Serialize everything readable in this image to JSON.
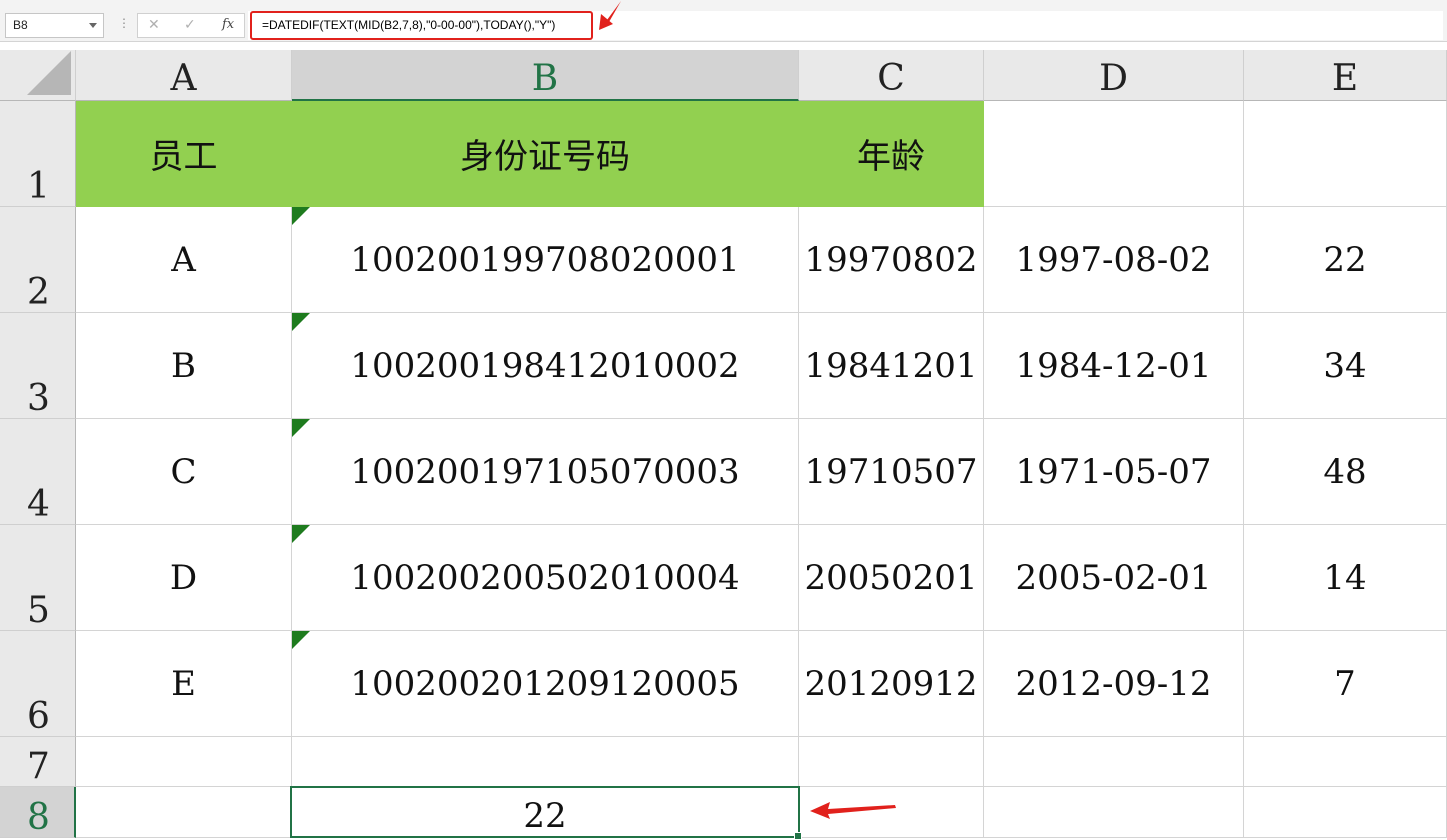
{
  "formula_bar": {
    "name_box": "B8",
    "cancel_symbol": "✕",
    "enter_symbol": "✓",
    "fx_label": "fx",
    "formula": "=DATEDIF(TEXT(MID(B2,7,8),\"0-00-00\"),TODAY(),\"Y\")"
  },
  "columns": [
    "A",
    "B",
    "C",
    "D",
    "E"
  ],
  "rows": [
    "1",
    "2",
    "3",
    "4",
    "5",
    "6",
    "7",
    "8"
  ],
  "header_row": {
    "a": "员工",
    "b": "身份证号码",
    "c": "年龄"
  },
  "data_rows": [
    {
      "a": "A",
      "b": "100200199708020001",
      "c": "19970802",
      "d": "1997-08-02",
      "e": "22"
    },
    {
      "a": "B",
      "b": "100200198412010002",
      "c": "19841201",
      "d": "1984-12-01",
      "e": "34"
    },
    {
      "a": "C",
      "b": "100200197105070003",
      "c": "19710507",
      "d": "1971-05-07",
      "e": "48"
    },
    {
      "a": "D",
      "b": "100200200502010004",
      "c": "20050201",
      "d": "2005-02-01",
      "e": "14"
    },
    {
      "a": "E",
      "b": "100200201209120005",
      "c": "20120912",
      "d": "2012-09-12",
      "e": "7"
    }
  ],
  "result_cell": "22",
  "colors": {
    "header_fill": "#92d050",
    "selection": "#217346",
    "annotation": "#e1211c",
    "error_triangle": "#1e7b1e"
  }
}
